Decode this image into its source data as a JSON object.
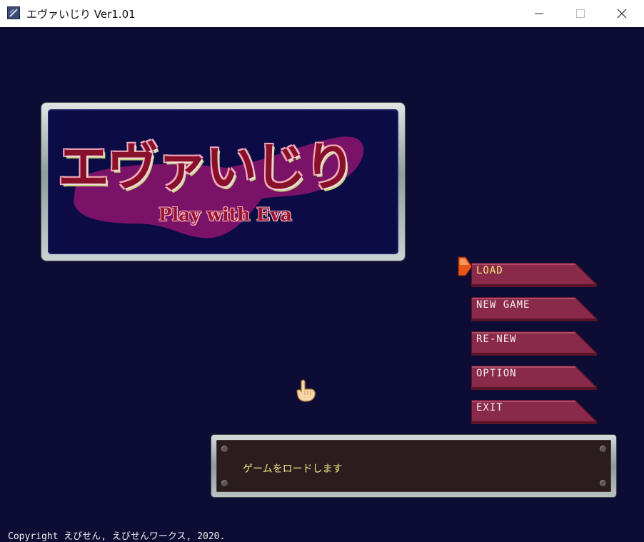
{
  "window": {
    "title": "エヴァいじり Ver1.01",
    "icons": {
      "app": "app-icon",
      "minimize": "minimize-icon",
      "maximize": "maximize-icon",
      "close": "close-icon"
    }
  },
  "logo": {
    "title": "エヴァいじり",
    "subtitle": "Play with Eva"
  },
  "menu": {
    "items": [
      {
        "label": "LOAD",
        "selected": true
      },
      {
        "label": "NEW GAME",
        "selected": false
      },
      {
        "label": "RE-NEW",
        "selected": false
      },
      {
        "label": "OPTION",
        "selected": false
      },
      {
        "label": "EXIT",
        "selected": false
      }
    ],
    "selector_icon": "arrow-selector-icon"
  },
  "message": {
    "text": "ゲームをロードします"
  },
  "cursor_icon": "hand-pointer-icon",
  "copyright": "Copyright えびせん, えびせんワークス, 2020.",
  "colors": {
    "background": "#0c0c34",
    "button": "#8a2a4a",
    "selected_text": "#f6ee7a",
    "message_text": "#f2ea86",
    "selector": "#e8561a"
  }
}
